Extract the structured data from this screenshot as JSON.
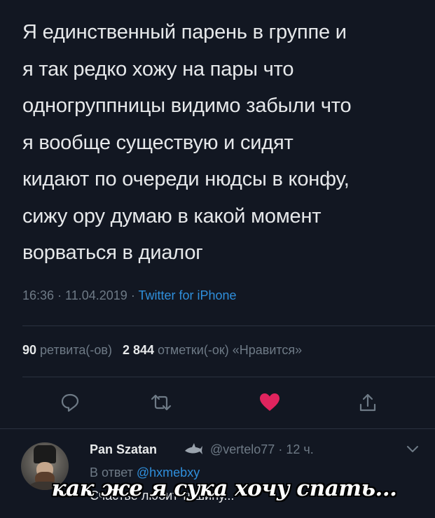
{
  "tweet": {
    "lines": [
      "Я единственный парень в группе и",
      "я так редко хожу на пары что",
      "одногруппницы видимо забыли что",
      "я вообще существую и сидят",
      "кидают по очереди нюдсы в конфу,",
      "сижу ору думаю в какой момент",
      "ворваться в диалог"
    ],
    "time": "16:36",
    "date": "11.04.2019",
    "sep": " · ",
    "source": "Twitter for iPhone"
  },
  "stats": {
    "retweets_count": "90",
    "retweets_label": "ретвита(-ов)",
    "likes_count": "2 844",
    "likes_label": "отметки(-ок) «Нравится»"
  },
  "colors": {
    "like": "#e0245e",
    "link": "#2f8fdc",
    "muted": "#6e7a86"
  },
  "reply": {
    "name": "Pan Szatan",
    "handle_time": "@vertelo77 · 12 ч.",
    "to_prefix": "В ответ ",
    "to_handle": "@hxmebxy",
    "text": "Счастье любит тишину..."
  },
  "caption": "как же я сука хочу спать...",
  "icons": [
    "reply-icon",
    "retweet-icon",
    "heart-icon",
    "share-icon",
    "chevron-down-icon",
    "shark-emoji-icon"
  ]
}
